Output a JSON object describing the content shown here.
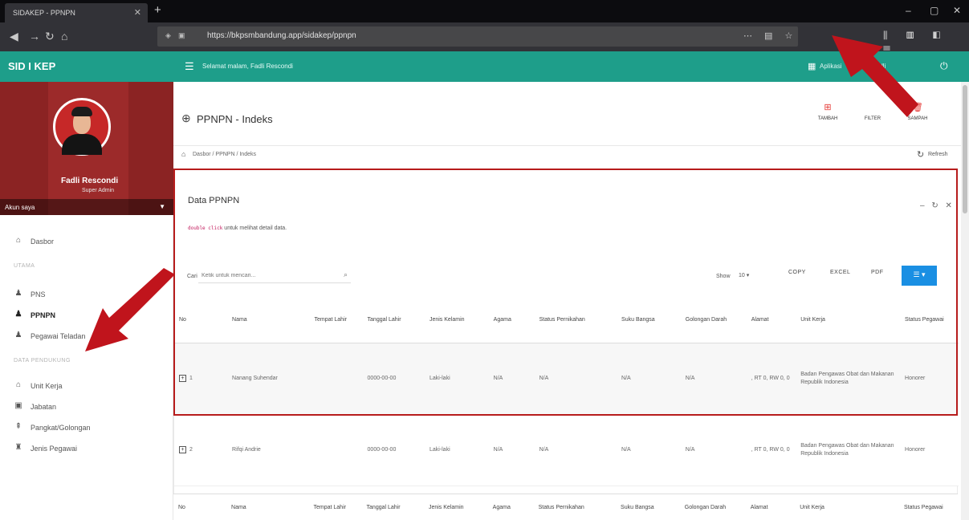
{
  "browser": {
    "tab_title": "SIDAKEP - PPNPN",
    "url": "https://bkpsmbandung.app/sidakep/ppnpn",
    "window_controls": [
      "–",
      "▢",
      "✕"
    ]
  },
  "app": {
    "brand": "SID I KEP",
    "greeting": "Selamat malam, Fadli Rescondi",
    "apps_label": "Aplikasi",
    "user_label": "Fadli",
    "accent_color": "#1e9e8a"
  },
  "profile": {
    "name": "Fadli Rescondi",
    "role": "Super Admin",
    "akun_label": "Akun saya"
  },
  "sidebar": {
    "items": [
      {
        "label": "Dasbor",
        "icon": "home-icon"
      },
      {
        "label": "PNS",
        "icon": "user-icon"
      },
      {
        "label": "PPNPN",
        "icon": "user-icon",
        "active": true
      },
      {
        "label": "Pegawai Teladan",
        "icon": "user-icon"
      },
      {
        "label": "Unit Kerja",
        "icon": "building-icon"
      },
      {
        "label": "Jabatan",
        "icon": "id-card-icon"
      },
      {
        "label": "Pangkat/Golongan",
        "icon": "rank-icon"
      },
      {
        "label": "Jenis Pegawai",
        "icon": "user-group-icon"
      }
    ],
    "section_utama": "UTAMA",
    "section_data": "DATA PENDUKUNG"
  },
  "page": {
    "title": "PPNPN - Indeks",
    "actions": [
      {
        "label": "TAMBAH",
        "icon": "add-icon"
      },
      {
        "label": "FILTER",
        "icon": "filter-icon"
      },
      {
        "label": "SAMPAH",
        "icon": "trash-icon"
      }
    ],
    "breadcrumb": "Dasbor  /  PPNPN  /  Indeks",
    "refresh_label": "Refresh"
  },
  "card": {
    "title": "Data PPNPN",
    "hint_code": "double click",
    "hint_text": " untuk melihat detail data.",
    "search_label": "Cari",
    "search_placeholder": "Ketik untuk mencari...",
    "show_label": "Show",
    "show_value": "10",
    "buttons": [
      "COPY",
      "EXCEL",
      "PDF"
    ]
  },
  "table": {
    "headers": [
      "No",
      "Nama",
      "Tempat Lahir",
      "Tanggal Lahir",
      "Jenis Kelamin",
      "Agama",
      "Status Pernikahan",
      "Suku Bangsa",
      "Golongan Darah",
      "Alamat",
      "Unit Kerja",
      "Status Pegawai"
    ],
    "rows": [
      {
        "no": "1",
        "nama": "Nanang Suhendar",
        "tempat": "",
        "tanggal": "0000-00-00",
        "jk": "Laki-laki",
        "agama": "N/A",
        "status_nikah": "N/A",
        "suku": "N/A",
        "goldar": "N/A",
        "alamat": ", RT 0, RW 0, 0",
        "unit": "Badan Pengawas Obat dan Makanan Republik Indonesia",
        "status": "Honorer"
      },
      {
        "no": "2",
        "nama": "Rifqi Andrie",
        "tempat": "",
        "tanggal": "0000-00-00",
        "jk": "Laki-laki",
        "agama": "N/A",
        "status_nikah": "N/A",
        "suku": "N/A",
        "goldar": "N/A",
        "alamat": ", RT 0, RW 0, 0",
        "unit": "Badan Pengawas Obat dan Makanan Republik Indonesia",
        "status": "Honorer"
      }
    ]
  },
  "annotation_color": "#c0141c"
}
